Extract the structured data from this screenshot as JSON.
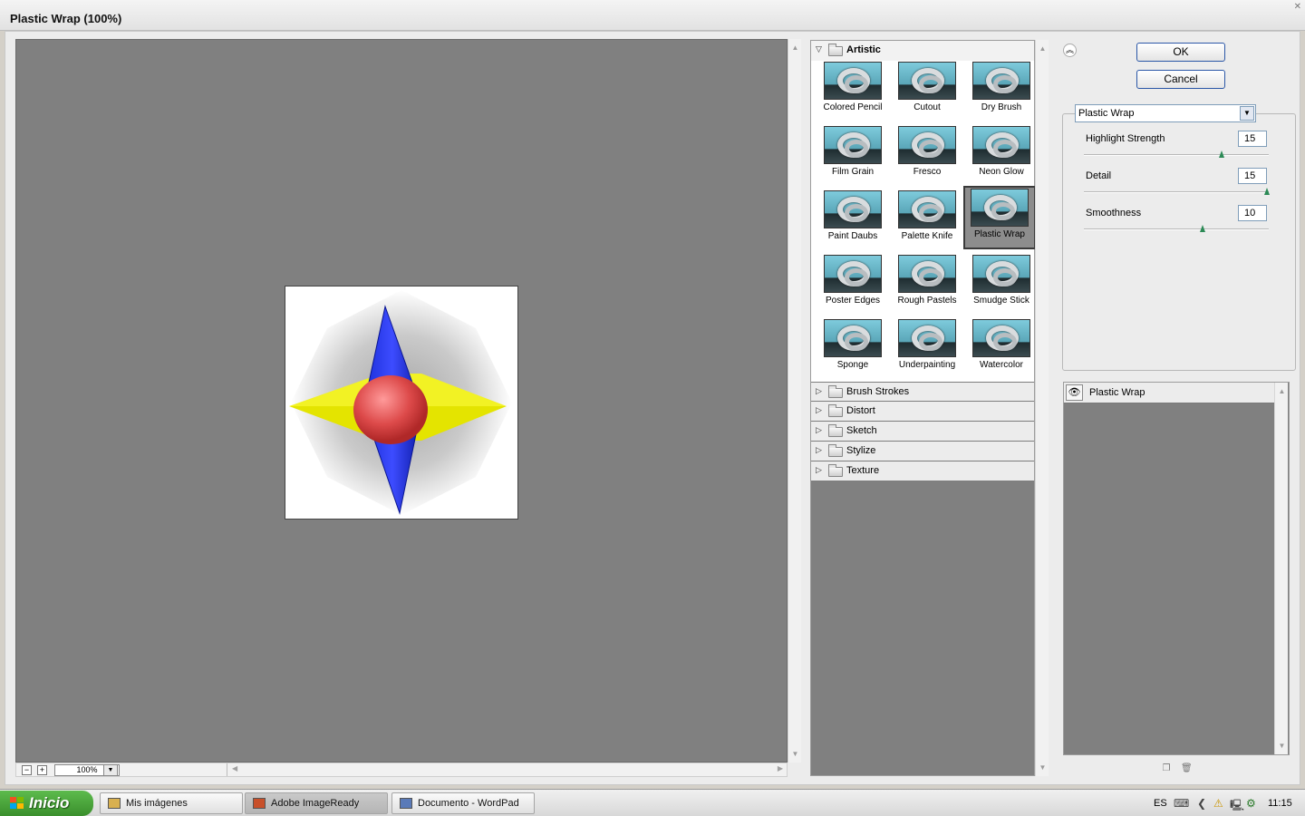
{
  "window": {
    "title": "Plastic Wrap (100%)"
  },
  "preview": {
    "zoom": "100%",
    "zoom_minus": "−",
    "zoom_plus": "+"
  },
  "gallery": {
    "open_category": "Artistic",
    "thumbs": [
      {
        "label": "Colored Pencil",
        "id": "colored-pencil"
      },
      {
        "label": "Cutout",
        "id": "cutout"
      },
      {
        "label": "Dry Brush",
        "id": "dry-brush"
      },
      {
        "label": "Film Grain",
        "id": "film-grain"
      },
      {
        "label": "Fresco",
        "id": "fresco"
      },
      {
        "label": "Neon Glow",
        "id": "neon-glow"
      },
      {
        "label": "Paint Daubs",
        "id": "paint-daubs"
      },
      {
        "label": "Palette Knife",
        "id": "palette-knife"
      },
      {
        "label": "Plastic Wrap",
        "id": "plastic-wrap"
      },
      {
        "label": "Poster Edges",
        "id": "poster-edges"
      },
      {
        "label": "Rough Pastels",
        "id": "rough-pastels"
      },
      {
        "label": "Smudge Stick",
        "id": "smudge-stick"
      },
      {
        "label": "Sponge",
        "id": "sponge"
      },
      {
        "label": "Underpainting",
        "id": "underpainting"
      },
      {
        "label": "Watercolor",
        "id": "watercolor"
      }
    ],
    "selected": "Plastic Wrap",
    "categories": [
      {
        "label": "Brush Strokes",
        "id": "brush-strokes"
      },
      {
        "label": "Distort",
        "id": "distort"
      },
      {
        "label": "Sketch",
        "id": "sketch"
      },
      {
        "label": "Stylize",
        "id": "stylize"
      },
      {
        "label": "Texture",
        "id": "texture"
      }
    ]
  },
  "buttons": {
    "ok": "OK",
    "cancel": "Cancel"
  },
  "settings": {
    "filter_selected": "Plastic Wrap",
    "params": [
      {
        "label": "Highlight Strength",
        "id": "highlight-strength",
        "value": "15",
        "min": 0,
        "max": 20
      },
      {
        "label": "Detail",
        "id": "detail",
        "value": "15",
        "min": 1,
        "max": 15
      },
      {
        "label": "Smoothness",
        "id": "smoothness",
        "value": "10",
        "min": 1,
        "max": 15
      }
    ]
  },
  "layers": {
    "items": [
      {
        "label": "Plastic Wrap"
      }
    ]
  },
  "taskbar": {
    "start_label": "Inicio",
    "tasks": [
      {
        "label": "Mis imágenes",
        "id": "mis-imagenes"
      },
      {
        "label": "Adobe ImageReady",
        "id": "adobe-imageready"
      },
      {
        "label": "Documento - WordPad",
        "id": "documento-wordpad"
      }
    ],
    "tray": {
      "language": "ES",
      "clock": "11:15"
    }
  }
}
